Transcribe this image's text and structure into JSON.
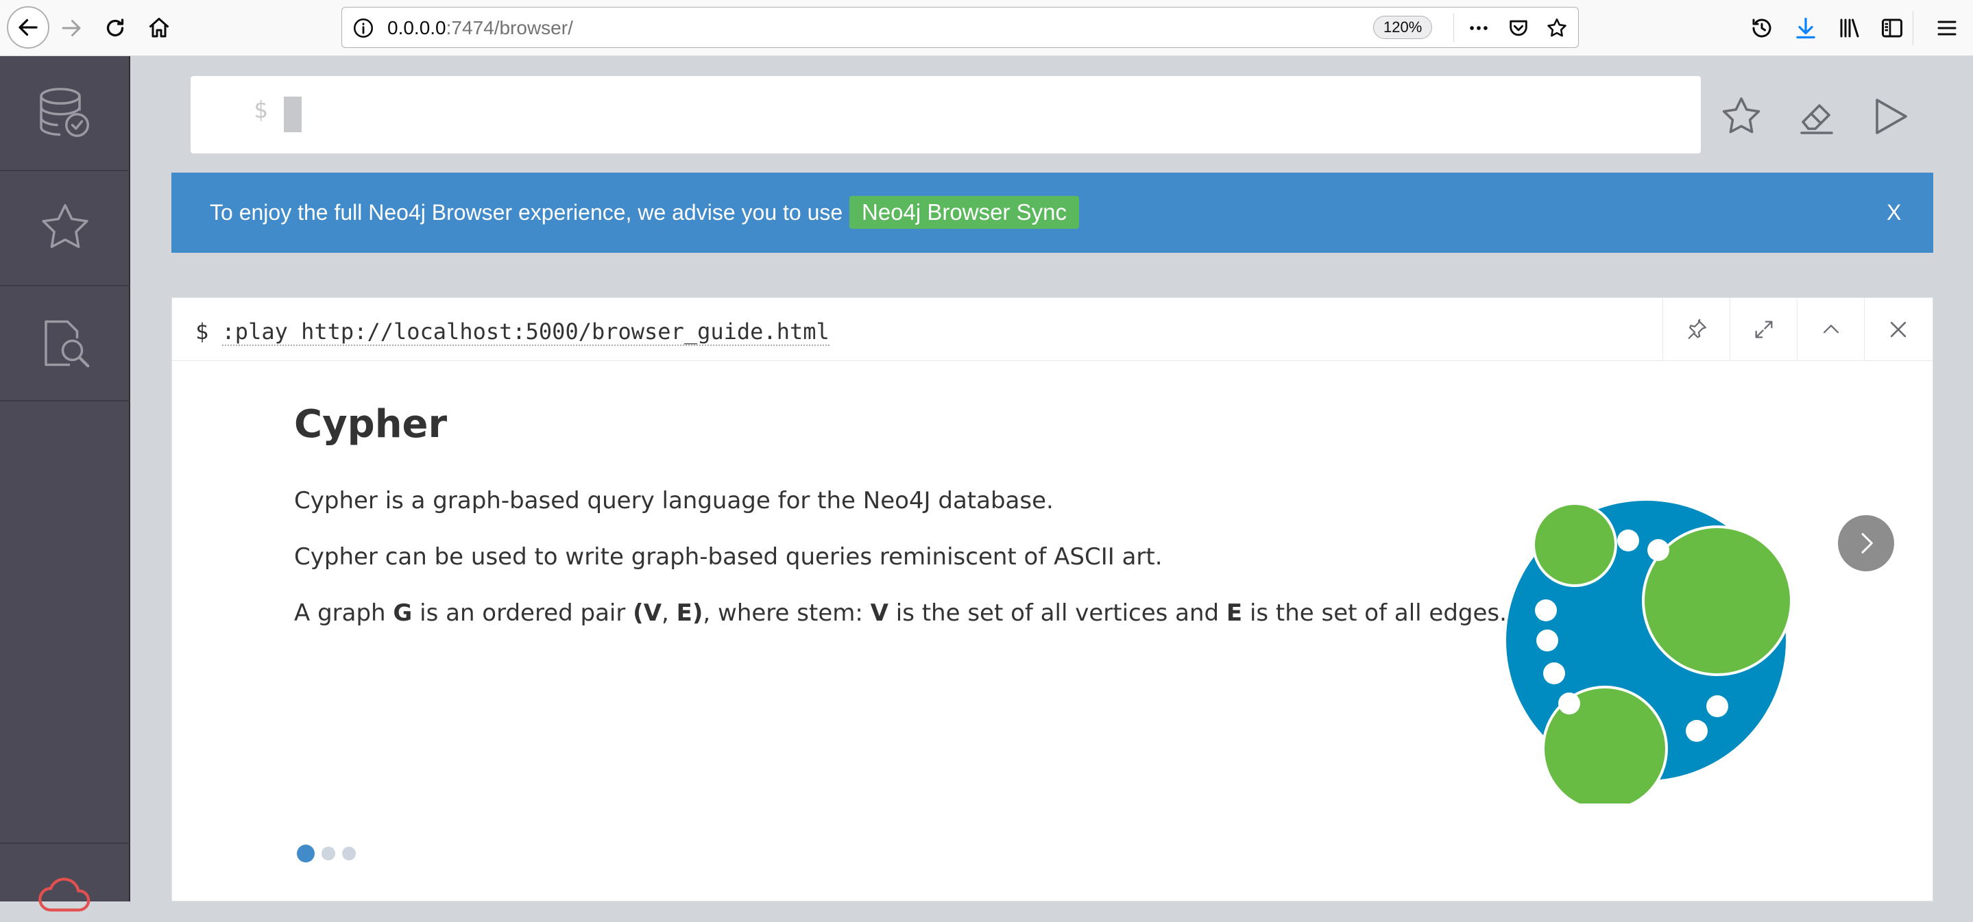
{
  "browser": {
    "url_host": "0.0.0.0",
    "url_rest": ":7474/browser/",
    "zoom": "120%"
  },
  "editor": {
    "prompt": "$"
  },
  "banner": {
    "text": "To enjoy the full Neo4j Browser experience, we advise you to use",
    "button_label": "Neo4j Browser Sync",
    "close_label": "X"
  },
  "frame": {
    "prompt": "$",
    "command": ":play http://localhost:5000/browser_guide.html"
  },
  "guide": {
    "title": "Cypher",
    "p1": "Cypher is a graph-based query language for the Neo4J database.",
    "p2": "Cypher can be used to write graph-based queries reminiscent of ASCII art.",
    "p3": {
      "t1": "A graph ",
      "b1": "G",
      "t2": " is an ordered pair ",
      "b2": "(V",
      "t3": ", ",
      "b3": "E)",
      "t4": ", where stem: ",
      "b4": "V",
      "t5": " is the set of all vertices and ",
      "b5": "E",
      "t6": " is the set of all edges."
    },
    "slides": 3,
    "active_slide": 1
  },
  "colors": {
    "banner": "#428bca",
    "sync_button": "#5cb85c",
    "sidebar": "#4d4a57",
    "logo_blue": "#008cc1",
    "logo_green": "#68bc44"
  }
}
